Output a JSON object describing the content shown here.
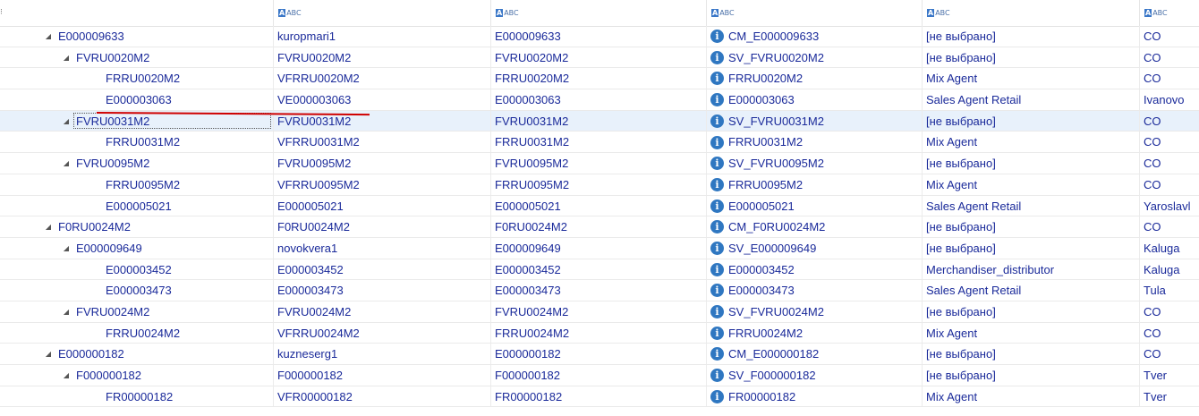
{
  "headers": [
    {
      "type_label": "ABC"
    },
    {
      "type_label": "ABC"
    },
    {
      "type_label": "ABC"
    },
    {
      "type_label": "ABC"
    },
    {
      "type_label": "ABC"
    }
  ],
  "rows": [
    {
      "level": 1,
      "expanded": true,
      "c0": "E000009633",
      "c1": "kuropmari1",
      "c2": "E000009633",
      "c3": "CM_E000009633",
      "c4": "[не выбрано]",
      "c5": "CO"
    },
    {
      "level": 2,
      "expanded": true,
      "c0": "FVRU0020M2",
      "c1": "FVRU0020M2",
      "c2": "FVRU0020M2",
      "c3": "SV_FVRU0020M2",
      "c4": "[не выбрано]",
      "c5": "CO"
    },
    {
      "level": 3,
      "c0": "FRRU0020M2",
      "c1": "VFRRU0020M2",
      "c2": "FRRU0020M2",
      "c3": "FRRU0020M2",
      "c4": "Mix Agent",
      "c5": "CO"
    },
    {
      "level": 3,
      "c0": "E000003063",
      "c1": "VE000003063",
      "c2": "E000003063",
      "c3": "E000003063",
      "c4": "Sales Agent Retail",
      "c5": "Ivanovo"
    },
    {
      "level": 2,
      "expanded": true,
      "selected": true,
      "c0": "FVRU0031M2",
      "c1": "FVRU0031M2",
      "c2": "FVRU0031M2",
      "c3": "SV_FVRU0031M2",
      "c4": "[не выбрано]",
      "c5": "CO"
    },
    {
      "level": 3,
      "c0": "FRRU0031M2",
      "c1": "VFRRU0031M2",
      "c2": "FRRU0031M2",
      "c3": "FRRU0031M2",
      "c4": "Mix Agent",
      "c5": "CO"
    },
    {
      "level": 2,
      "expanded": true,
      "c0": "FVRU0095M2",
      "c1": "FVRU0095M2",
      "c2": "FVRU0095M2",
      "c3": "SV_FVRU0095M2",
      "c4": "[не выбрано]",
      "c5": "CO"
    },
    {
      "level": 3,
      "c0": "FRRU0095M2",
      "c1": "VFRRU0095M2",
      "c2": "FRRU0095M2",
      "c3": "FRRU0095M2",
      "c4": "Mix Agent",
      "c5": "CO"
    },
    {
      "level": 3,
      "c0": "E000005021",
      "c1": "E000005021",
      "c2": "E000005021",
      "c3": "E000005021",
      "c4": "Sales Agent Retail",
      "c5": "Yaroslavl"
    },
    {
      "level": 1,
      "expanded": true,
      "c0": "F0RU0024M2",
      "c1": "F0RU0024M2",
      "c2": "F0RU0024M2",
      "c3": "CM_F0RU0024M2",
      "c4": "[не выбрано]",
      "c5": "CO"
    },
    {
      "level": 2,
      "expanded": true,
      "c0": "E000009649",
      "c1": "novokvera1",
      "c2": "E000009649",
      "c3": "SV_E000009649",
      "c4": "[не выбрано]",
      "c5": "Kaluga"
    },
    {
      "level": 3,
      "c0": "E000003452",
      "c1": "E000003452",
      "c2": "E000003452",
      "c3": "E000003452",
      "c4": "Merchandiser_distributor",
      "c5": "Kaluga"
    },
    {
      "level": 3,
      "c0": "E000003473",
      "c1": "E000003473",
      "c2": "E000003473",
      "c3": "E000003473",
      "c4": "Sales Agent Retail",
      "c5": "Tula"
    },
    {
      "level": 2,
      "expanded": true,
      "c0": "FVRU0024M2",
      "c1": "FVRU0024M2",
      "c2": "FVRU0024M2",
      "c3": "SV_FVRU0024M2",
      "c4": "[не выбрано]",
      "c5": "CO"
    },
    {
      "level": 3,
      "c0": "FRRU0024M2",
      "c1": "VFRRU0024M2",
      "c2": "FRRU0024M2",
      "c3": "FRRU0024M2",
      "c4": "Mix Agent",
      "c5": "CO"
    },
    {
      "level": 1,
      "expanded": true,
      "c0": "E000000182",
      "c1": "kuzneserg1",
      "c2": "E000000182",
      "c3": "CM_E000000182",
      "c4": "[не выбрано]",
      "c5": "CO"
    },
    {
      "level": 2,
      "expanded": true,
      "c0": "F000000182",
      "c1": "F000000182",
      "c2": "F000000182",
      "c3": "SV_F000000182",
      "c4": "[не выбрано]",
      "c5": "Tver"
    },
    {
      "level": 3,
      "c0": "FR00000182",
      "c1": "VFR00000182",
      "c2": "FR00000182",
      "c3": "FR00000182",
      "c4": "Mix Agent",
      "c5": "Tver"
    }
  ],
  "icons": {
    "expander": "expanded-triangle-icon",
    "info": "info-icon",
    "type": "text-type-icon"
  },
  "colors": {
    "text": "#1a2a9a",
    "info_icon": "#2f77c1",
    "selected_row": "#e8f1fb",
    "annotation": "#d00000"
  }
}
